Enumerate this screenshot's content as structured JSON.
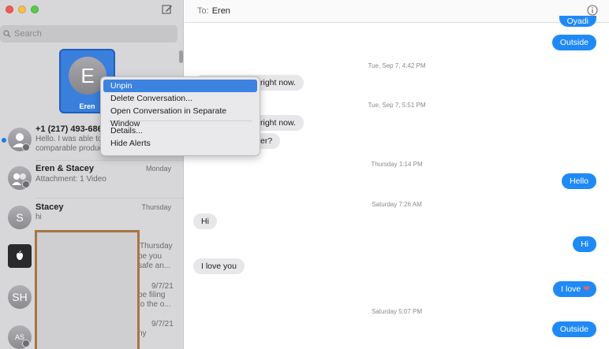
{
  "sidebar": {
    "search_placeholder": "Search",
    "pinned": {
      "initial": "E",
      "name": "Eren"
    },
    "conversations": [
      {
        "title": "+1 (217) 493-686",
        "date": "",
        "preview_line1": "Hello. I was able to",
        "preview_line2": "comparable produc"
      },
      {
        "title": "Eren & Stacey",
        "date": "Monday",
        "preview_line1": "Attachment: 1 Video",
        "preview_line2": ""
      },
      {
        "title": "Stacey",
        "date": "Thursday",
        "preview_line1": "hi",
        "preview_line2": ""
      }
    ],
    "avatars": [
      "S",
      "SH",
      "AS"
    ],
    "obscured_rows": [
      {
        "date": "Thursday",
        "line1": "be you",
        "line2": "safe an..."
      },
      {
        "date": "9/7/21",
        "line1": "be filing",
        "line2": "to the o..."
      },
      {
        "date": "9/7/21",
        "line1": "ny",
        "line2": ""
      }
    ]
  },
  "context_menu": {
    "items": [
      "Unpin",
      "Delete Conversation...",
      "Open Conversation in Separate Window",
      "Details...",
      "Hide Alerts"
    ]
  },
  "header": {
    "to_label": "To:",
    "recipient": "Eren"
  },
  "messages": {
    "top_partial": "Oyadi",
    "outside_1": "Outside",
    "ts_1": "Tue, Sep 7, 4:42 PM",
    "in_1": "right now.",
    "ts_2": "Tue, Sep 7, 5:51 PM",
    "in_2": "right now.",
    "in_3": "er?",
    "ts_3": "Thursday 1:14 PM",
    "hello": "Hello",
    "ts_4": "Saturday 7:26 AM",
    "in_hi": "Hi",
    "out_hi": "Hi",
    "in_love": "I love you",
    "out_love": "I love",
    "heart": "❤",
    "ts_5": "Saturday 5:07 PM",
    "outside_2": "Outside"
  }
}
